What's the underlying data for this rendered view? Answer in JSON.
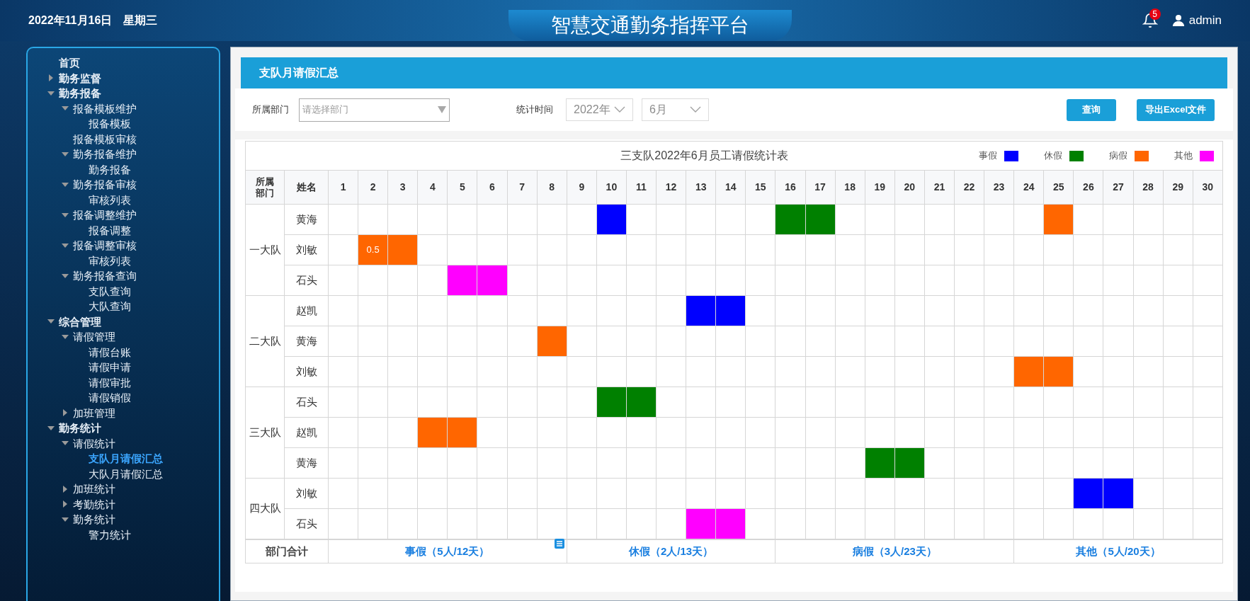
{
  "header": {
    "date": "2022年11月16日",
    "weekday": "星期三",
    "title": "智慧交通勤务指挥平台",
    "notifications": "5",
    "user": "admin"
  },
  "sidebar": {
    "items": [
      {
        "label": "首页",
        "selected": false
      },
      {
        "label": "勤务监督",
        "expanded": false,
        "selected": false
      },
      {
        "label": "勤务报备",
        "expanded": true,
        "selected": false,
        "children": [
          {
            "label": "报备模板维护",
            "expanded": true,
            "selected": false,
            "children": [
              {
                "label": "报备模板",
                "selected": false
              }
            ]
          },
          {
            "label": "报备模板审核",
            "selected": false
          },
          {
            "label": "勤务报备维护",
            "expanded": true,
            "selected": false,
            "children": [
              {
                "label": "勤务报备",
                "selected": false
              }
            ]
          },
          {
            "label": "勤务报备审核",
            "expanded": true,
            "selected": false,
            "children": [
              {
                "label": "审核列表",
                "selected": false
              }
            ]
          },
          {
            "label": "报备调整维护",
            "expanded": true,
            "selected": false,
            "children": [
              {
                "label": "报备调整",
                "selected": false
              }
            ]
          },
          {
            "label": "报备调整审核",
            "expanded": true,
            "selected": false,
            "children": [
              {
                "label": "审核列表",
                "selected": false
              }
            ]
          },
          {
            "label": "勤务报备查询",
            "expanded": true,
            "selected": false,
            "children": [
              {
                "label": "支队查询",
                "selected": false
              },
              {
                "label": "大队查询",
                "selected": false
              }
            ]
          }
        ]
      },
      {
        "label": "综合管理",
        "expanded": true,
        "selected": false,
        "children": [
          {
            "label": "请假管理",
            "expanded": true,
            "selected": false,
            "children": [
              {
                "label": "请假台账",
                "selected": false
              },
              {
                "label": "请假申请",
                "selected": false
              },
              {
                "label": "请假审批",
                "selected": false
              },
              {
                "label": "请假销假",
                "selected": false
              }
            ]
          },
          {
            "label": "加班管理",
            "expanded": false,
            "selected": false
          }
        ]
      },
      {
        "label": "勤务统计",
        "expanded": true,
        "selected": false,
        "children": [
          {
            "label": "请假统计",
            "expanded": true,
            "selected": false,
            "children": [
              {
                "label": "支队月请假汇总",
                "selected": true
              },
              {
                "label": "大队月请假汇总",
                "selected": false
              }
            ]
          },
          {
            "label": "加班统计",
            "expanded": false,
            "selected": false
          },
          {
            "label": "考勤统计",
            "expanded": false,
            "selected": false
          },
          {
            "label": "勤务统计",
            "expanded": true,
            "selected": false,
            "children": [
              {
                "label": "警力统计",
                "selected": false
              }
            ]
          }
        ]
      }
    ]
  },
  "page": {
    "title": "支队月请假汇总",
    "filters": {
      "department_label": "所属部门",
      "department_placeholder": "请选择部门",
      "time_label": "统计时间",
      "year": "2022年",
      "month": "6月",
      "query_button": "查询",
      "export_button": "导出Excel文件"
    },
    "table": {
      "title": "三支队2022年6月员工请假统计表",
      "legend": [
        {
          "label": "事假",
          "kind": "personal",
          "color": "#0000ff"
        },
        {
          "label": "休假",
          "kind": "rest",
          "color": "#008000"
        },
        {
          "label": "病假",
          "kind": "sick",
          "color": "#ff6600"
        },
        {
          "label": "其他",
          "kind": "other",
          "color": "#ff00ff"
        }
      ],
      "columns": {
        "department": "所属部门",
        "name": "姓名"
      },
      "days": [
        "1",
        "2",
        "3",
        "4",
        "5",
        "6",
        "7",
        "8",
        "9",
        "10",
        "11",
        "12",
        "13",
        "14",
        "15",
        "16",
        "17",
        "18",
        "19",
        "20",
        "21",
        "22",
        "23",
        "24",
        "25",
        "26",
        "27",
        "28",
        "29",
        "30"
      ],
      "departments": [
        {
          "name": "一大队",
          "members": [
            {
              "name": "黄海",
              "cells": [
                {
                  "kind": "empty"
                },
                {
                  "kind": "empty"
                },
                {
                  "kind": "empty"
                },
                {
                  "kind": "empty"
                },
                {
                  "kind": "empty"
                },
                {
                  "kind": "empty"
                },
                {
                  "kind": "empty"
                },
                {
                  "kind": "empty"
                },
                {
                  "kind": "empty"
                },
                {
                  "kind": "personal"
                },
                {
                  "kind": "empty"
                },
                {
                  "kind": "empty"
                },
                {
                  "kind": "empty"
                },
                {
                  "kind": "empty"
                },
                {
                  "kind": "empty"
                },
                {
                  "kind": "rest"
                },
                {
                  "kind": "rest"
                },
                {
                  "kind": "empty"
                },
                {
                  "kind": "empty"
                },
                {
                  "kind": "empty"
                },
                {
                  "kind": "empty"
                },
                {
                  "kind": "empty"
                },
                {
                  "kind": "empty"
                },
                {
                  "kind": "empty"
                },
                {
                  "kind": "sick"
                },
                {
                  "kind": "empty"
                },
                {
                  "kind": "empty"
                },
                {
                  "kind": "empty"
                },
                {
                  "kind": "empty"
                },
                {
                  "kind": "empty"
                }
              ]
            },
            {
              "name": "刘敏",
              "cells": [
                {
                  "kind": "empty"
                },
                {
                  "kind": "sick",
                  "label": "0.5"
                },
                {
                  "kind": "sick"
                },
                {
                  "kind": "empty"
                },
                {
                  "kind": "empty"
                },
                {
                  "kind": "empty"
                },
                {
                  "kind": "empty"
                },
                {
                  "kind": "empty"
                },
                {
                  "kind": "empty"
                },
                {
                  "kind": "empty"
                },
                {
                  "kind": "empty"
                },
                {
                  "kind": "empty"
                },
                {
                  "kind": "empty"
                },
                {
                  "kind": "empty"
                },
                {
                  "kind": "empty"
                },
                {
                  "kind": "empty"
                },
                {
                  "kind": "empty"
                },
                {
                  "kind": "empty"
                },
                {
                  "kind": "empty"
                },
                {
                  "kind": "empty"
                },
                {
                  "kind": "empty"
                },
                {
                  "kind": "empty"
                },
                {
                  "kind": "empty"
                },
                {
                  "kind": "empty"
                },
                {
                  "kind": "empty"
                },
                {
                  "kind": "empty"
                },
                {
                  "kind": "empty"
                },
                {
                  "kind": "empty"
                },
                {
                  "kind": "empty"
                },
                {
                  "kind": "empty"
                }
              ]
            },
            {
              "name": "石头",
              "cells": [
                {
                  "kind": "empty"
                },
                {
                  "kind": "empty"
                },
                {
                  "kind": "empty"
                },
                {
                  "kind": "empty"
                },
                {
                  "kind": "other"
                },
                {
                  "kind": "other"
                },
                {
                  "kind": "empty"
                },
                {
                  "kind": "empty"
                },
                {
                  "kind": "empty"
                },
                {
                  "kind": "empty"
                },
                {
                  "kind": "empty"
                },
                {
                  "kind": "empty"
                },
                {
                  "kind": "empty"
                },
                {
                  "kind": "empty"
                },
                {
                  "kind": "empty"
                },
                {
                  "kind": "empty"
                },
                {
                  "kind": "empty"
                },
                {
                  "kind": "empty"
                },
                {
                  "kind": "empty"
                },
                {
                  "kind": "empty"
                },
                {
                  "kind": "empty"
                },
                {
                  "kind": "empty"
                },
                {
                  "kind": "empty"
                },
                {
                  "kind": "empty"
                },
                {
                  "kind": "empty"
                },
                {
                  "kind": "empty"
                },
                {
                  "kind": "empty"
                },
                {
                  "kind": "empty"
                },
                {
                  "kind": "empty"
                },
                {
                  "kind": "empty"
                }
              ]
            }
          ]
        },
        {
          "name": "二大队",
          "members": [
            {
              "name": "赵凯",
              "cells": [
                {
                  "kind": "empty"
                },
                {
                  "kind": "empty"
                },
                {
                  "kind": "empty"
                },
                {
                  "kind": "empty"
                },
                {
                  "kind": "empty"
                },
                {
                  "kind": "empty"
                },
                {
                  "kind": "empty"
                },
                {
                  "kind": "empty"
                },
                {
                  "kind": "empty"
                },
                {
                  "kind": "empty"
                },
                {
                  "kind": "empty"
                },
                {
                  "kind": "empty"
                },
                {
                  "kind": "personal"
                },
                {
                  "kind": "personal"
                },
                {
                  "kind": "empty"
                },
                {
                  "kind": "empty"
                },
                {
                  "kind": "empty"
                },
                {
                  "kind": "empty"
                },
                {
                  "kind": "empty"
                },
                {
                  "kind": "empty"
                },
                {
                  "kind": "empty"
                },
                {
                  "kind": "empty"
                },
                {
                  "kind": "empty"
                },
                {
                  "kind": "empty"
                },
                {
                  "kind": "empty"
                },
                {
                  "kind": "empty"
                },
                {
                  "kind": "empty"
                },
                {
                  "kind": "empty"
                },
                {
                  "kind": "empty"
                },
                {
                  "kind": "empty"
                }
              ]
            },
            {
              "name": "黄海",
              "cells": [
                {
                  "kind": "empty"
                },
                {
                  "kind": "empty"
                },
                {
                  "kind": "empty"
                },
                {
                  "kind": "empty"
                },
                {
                  "kind": "empty"
                },
                {
                  "kind": "empty"
                },
                {
                  "kind": "empty"
                },
                {
                  "kind": "sick"
                },
                {
                  "kind": "empty"
                },
                {
                  "kind": "empty"
                },
                {
                  "kind": "empty"
                },
                {
                  "kind": "empty"
                },
                {
                  "kind": "empty"
                },
                {
                  "kind": "empty"
                },
                {
                  "kind": "empty"
                },
                {
                  "kind": "empty"
                },
                {
                  "kind": "empty"
                },
                {
                  "kind": "empty"
                },
                {
                  "kind": "empty"
                },
                {
                  "kind": "empty"
                },
                {
                  "kind": "empty"
                },
                {
                  "kind": "empty"
                },
                {
                  "kind": "empty"
                },
                {
                  "kind": "empty"
                },
                {
                  "kind": "empty"
                },
                {
                  "kind": "empty"
                },
                {
                  "kind": "empty"
                },
                {
                  "kind": "empty"
                },
                {
                  "kind": "empty"
                },
                {
                  "kind": "empty"
                }
              ]
            },
            {
              "name": "刘敏",
              "cells": [
                {
                  "kind": "empty"
                },
                {
                  "kind": "empty"
                },
                {
                  "kind": "empty"
                },
                {
                  "kind": "empty"
                },
                {
                  "kind": "empty"
                },
                {
                  "kind": "empty"
                },
                {
                  "kind": "empty"
                },
                {
                  "kind": "empty"
                },
                {
                  "kind": "empty"
                },
                {
                  "kind": "empty"
                },
                {
                  "kind": "empty"
                },
                {
                  "kind": "empty"
                },
                {
                  "kind": "empty"
                },
                {
                  "kind": "empty"
                },
                {
                  "kind": "empty"
                },
                {
                  "kind": "empty"
                },
                {
                  "kind": "empty"
                },
                {
                  "kind": "empty"
                },
                {
                  "kind": "empty"
                },
                {
                  "kind": "empty"
                },
                {
                  "kind": "empty"
                },
                {
                  "kind": "empty"
                },
                {
                  "kind": "empty"
                },
                {
                  "kind": "sick"
                },
                {
                  "kind": "sick"
                },
                {
                  "kind": "empty"
                },
                {
                  "kind": "empty"
                },
                {
                  "kind": "empty"
                },
                {
                  "kind": "empty"
                },
                {
                  "kind": "empty"
                }
              ]
            }
          ]
        },
        {
          "name": "三大队",
          "members": [
            {
              "name": "石头",
              "cells": [
                {
                  "kind": "empty"
                },
                {
                  "kind": "empty"
                },
                {
                  "kind": "empty"
                },
                {
                  "kind": "empty"
                },
                {
                  "kind": "empty"
                },
                {
                  "kind": "empty"
                },
                {
                  "kind": "empty"
                },
                {
                  "kind": "empty"
                },
                {
                  "kind": "empty"
                },
                {
                  "kind": "rest"
                },
                {
                  "kind": "rest"
                },
                {
                  "kind": "empty"
                },
                {
                  "kind": "empty"
                },
                {
                  "kind": "empty"
                },
                {
                  "kind": "empty"
                },
                {
                  "kind": "empty"
                },
                {
                  "kind": "empty"
                },
                {
                  "kind": "empty"
                },
                {
                  "kind": "empty"
                },
                {
                  "kind": "empty"
                },
                {
                  "kind": "empty"
                },
                {
                  "kind": "empty"
                },
                {
                  "kind": "empty"
                },
                {
                  "kind": "empty"
                },
                {
                  "kind": "empty"
                },
                {
                  "kind": "empty"
                },
                {
                  "kind": "empty"
                },
                {
                  "kind": "empty"
                },
                {
                  "kind": "empty"
                },
                {
                  "kind": "empty"
                }
              ]
            },
            {
              "name": "赵凯",
              "cells": [
                {
                  "kind": "empty"
                },
                {
                  "kind": "empty"
                },
                {
                  "kind": "empty"
                },
                {
                  "kind": "sick"
                },
                {
                  "kind": "sick"
                },
                {
                  "kind": "empty"
                },
                {
                  "kind": "empty"
                },
                {
                  "kind": "empty"
                },
                {
                  "kind": "empty"
                },
                {
                  "kind": "empty"
                },
                {
                  "kind": "empty"
                },
                {
                  "kind": "empty"
                },
                {
                  "kind": "empty"
                },
                {
                  "kind": "empty"
                },
                {
                  "kind": "empty"
                },
                {
                  "kind": "empty"
                },
                {
                  "kind": "empty"
                },
                {
                  "kind": "empty"
                },
                {
                  "kind": "empty"
                },
                {
                  "kind": "empty"
                },
                {
                  "kind": "empty"
                },
                {
                  "kind": "empty"
                },
                {
                  "kind": "empty"
                },
                {
                  "kind": "empty"
                },
                {
                  "kind": "empty"
                },
                {
                  "kind": "empty"
                },
                {
                  "kind": "empty"
                },
                {
                  "kind": "empty"
                },
                {
                  "kind": "empty"
                },
                {
                  "kind": "empty"
                }
              ]
            },
            {
              "name": "黄海",
              "cells": [
                {
                  "kind": "empty"
                },
                {
                  "kind": "empty"
                },
                {
                  "kind": "empty"
                },
                {
                  "kind": "empty"
                },
                {
                  "kind": "empty"
                },
                {
                  "kind": "empty"
                },
                {
                  "kind": "empty"
                },
                {
                  "kind": "empty"
                },
                {
                  "kind": "empty"
                },
                {
                  "kind": "empty"
                },
                {
                  "kind": "empty"
                },
                {
                  "kind": "empty"
                },
                {
                  "kind": "empty"
                },
                {
                  "kind": "empty"
                },
                {
                  "kind": "empty"
                },
                {
                  "kind": "empty"
                },
                {
                  "kind": "empty"
                },
                {
                  "kind": "empty"
                },
                {
                  "kind": "rest"
                },
                {
                  "kind": "rest"
                },
                {
                  "kind": "empty"
                },
                {
                  "kind": "empty"
                },
                {
                  "kind": "empty"
                },
                {
                  "kind": "empty"
                },
                {
                  "kind": "empty"
                },
                {
                  "kind": "empty"
                },
                {
                  "kind": "empty"
                },
                {
                  "kind": "empty"
                },
                {
                  "kind": "empty"
                },
                {
                  "kind": "empty"
                }
              ]
            }
          ]
        },
        {
          "name": "四大队",
          "members": [
            {
              "name": "刘敏",
              "cells": [
                {
                  "kind": "empty"
                },
                {
                  "kind": "empty"
                },
                {
                  "kind": "empty"
                },
                {
                  "kind": "empty"
                },
                {
                  "kind": "empty"
                },
                {
                  "kind": "empty"
                },
                {
                  "kind": "empty"
                },
                {
                  "kind": "empty"
                },
                {
                  "kind": "empty"
                },
                {
                  "kind": "empty"
                },
                {
                  "kind": "empty"
                },
                {
                  "kind": "empty"
                },
                {
                  "kind": "empty"
                },
                {
                  "kind": "empty"
                },
                {
                  "kind": "empty"
                },
                {
                  "kind": "empty"
                },
                {
                  "kind": "empty"
                },
                {
                  "kind": "empty"
                },
                {
                  "kind": "empty"
                },
                {
                  "kind": "empty"
                },
                {
                  "kind": "empty"
                },
                {
                  "kind": "empty"
                },
                {
                  "kind": "empty"
                },
                {
                  "kind": "empty"
                },
                {
                  "kind": "empty"
                },
                {
                  "kind": "personal"
                },
                {
                  "kind": "personal"
                },
                {
                  "kind": "empty"
                },
                {
                  "kind": "empty"
                },
                {
                  "kind": "empty"
                }
              ]
            },
            {
              "name": "石头",
              "cells": [
                {
                  "kind": "empty"
                },
                {
                  "kind": "empty"
                },
                {
                  "kind": "empty"
                },
                {
                  "kind": "empty"
                },
                {
                  "kind": "empty"
                },
                {
                  "kind": "empty"
                },
                {
                  "kind": "empty"
                },
                {
                  "kind": "empty"
                },
                {
                  "kind": "empty"
                },
                {
                  "kind": "empty"
                },
                {
                  "kind": "empty"
                },
                {
                  "kind": "empty"
                },
                {
                  "kind": "other"
                },
                {
                  "kind": "other"
                },
                {
                  "kind": "empty"
                },
                {
                  "kind": "empty"
                },
                {
                  "kind": "empty"
                },
                {
                  "kind": "empty"
                },
                {
                  "kind": "empty"
                },
                {
                  "kind": "empty"
                },
                {
                  "kind": "empty"
                },
                {
                  "kind": "empty"
                },
                {
                  "kind": "empty"
                },
                {
                  "kind": "empty"
                },
                {
                  "kind": "empty"
                },
                {
                  "kind": "empty"
                },
                {
                  "kind": "empty"
                },
                {
                  "kind": "empty"
                },
                {
                  "kind": "empty"
                },
                {
                  "kind": "empty"
                }
              ]
            }
          ]
        }
      ],
      "totals": {
        "label": "部门合计",
        "items": [
          "事假（5人/12天）",
          "休假（2人/13天）",
          "病假（3人/23天）",
          "其他（5人/20天）"
        ]
      }
    }
  }
}
